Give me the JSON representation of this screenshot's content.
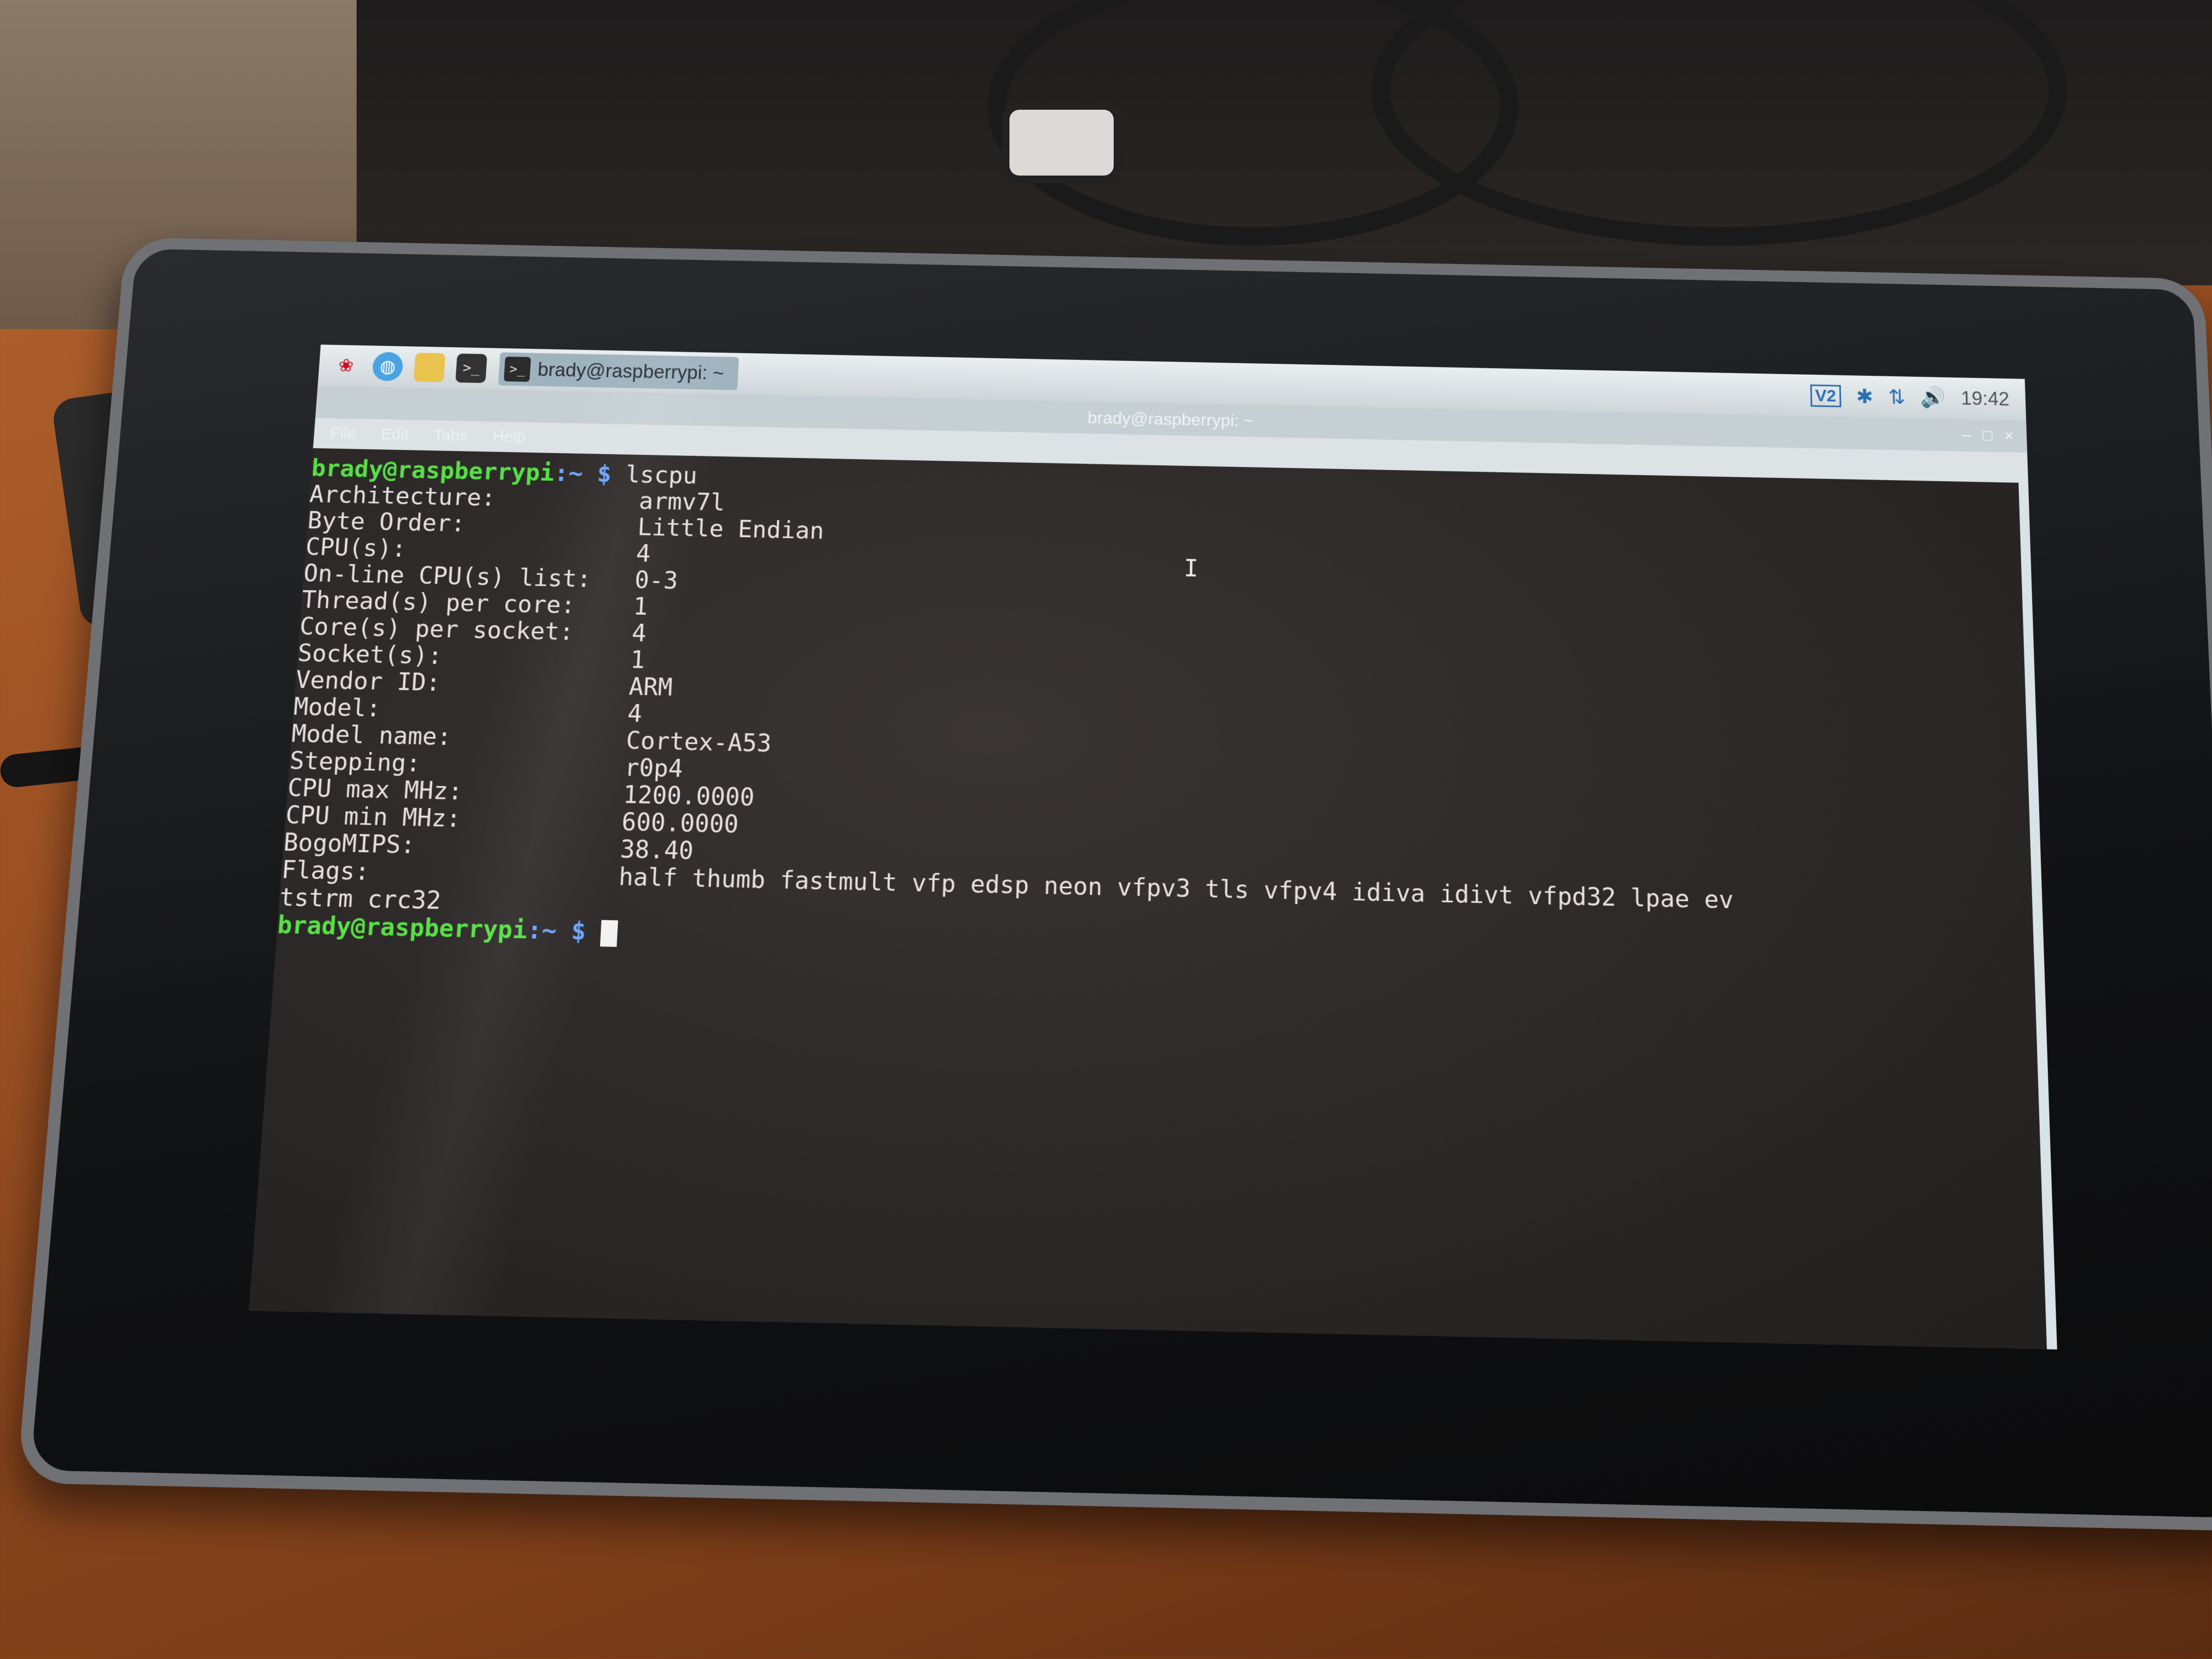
{
  "taskbar": {
    "launchers": [
      {
        "icon": "raspberry-menu-icon",
        "glyph": "❀"
      },
      {
        "icon": "web-browser-icon",
        "glyph": "◍"
      },
      {
        "icon": "file-manager-icon",
        "glyph": ""
      },
      {
        "icon": "terminal-launcher-icon",
        "glyph": ">_"
      }
    ],
    "task_label": "brady@raspberrypi: ~",
    "tray": {
      "vnc_label": "V2",
      "bluetooth_glyph": "✱",
      "network_glyph": "⇅",
      "volume_glyph": "🔊",
      "clock": "19:42"
    }
  },
  "window": {
    "title": "brady@raspberrypi: ~",
    "controls": {
      "minimize": "–",
      "maximize": "□",
      "close": "×"
    },
    "menu": [
      "File",
      "Edit",
      "Tabs",
      "Help"
    ]
  },
  "terminal": {
    "prompt_user": "brady@raspberrypi",
    "prompt_sep": ":~",
    "prompt_dollar": "$",
    "command": "lscpu",
    "rows": [
      {
        "label": "Architecture:",
        "value": "armv7l"
      },
      {
        "label": "Byte Order:",
        "value": "Little Endian"
      },
      {
        "label": "CPU(s):",
        "value": "4"
      },
      {
        "label": "On-line CPU(s) list:",
        "value": "0-3"
      },
      {
        "label": "Thread(s) per core:",
        "value": "1"
      },
      {
        "label": "Core(s) per socket:",
        "value": "4"
      },
      {
        "label": "Socket(s):",
        "value": "1"
      },
      {
        "label": "Vendor ID:",
        "value": "ARM"
      },
      {
        "label": "Model:",
        "value": "4"
      },
      {
        "label": "Model name:",
        "value": "Cortex-A53"
      },
      {
        "label": "Stepping:",
        "value": "r0p4"
      },
      {
        "label": "CPU max MHz:",
        "value": "1200.0000"
      },
      {
        "label": "CPU min MHz:",
        "value": "600.0000"
      },
      {
        "label": "BogoMIPS:",
        "value": "38.40"
      },
      {
        "label": "Flags:",
        "value": "half thumb fastmult vfp edsp neon vfpv3 tls vfpv4 idiva idivt vfpd32 lpae ev"
      }
    ],
    "wrap_line": "tstrm crc32"
  }
}
